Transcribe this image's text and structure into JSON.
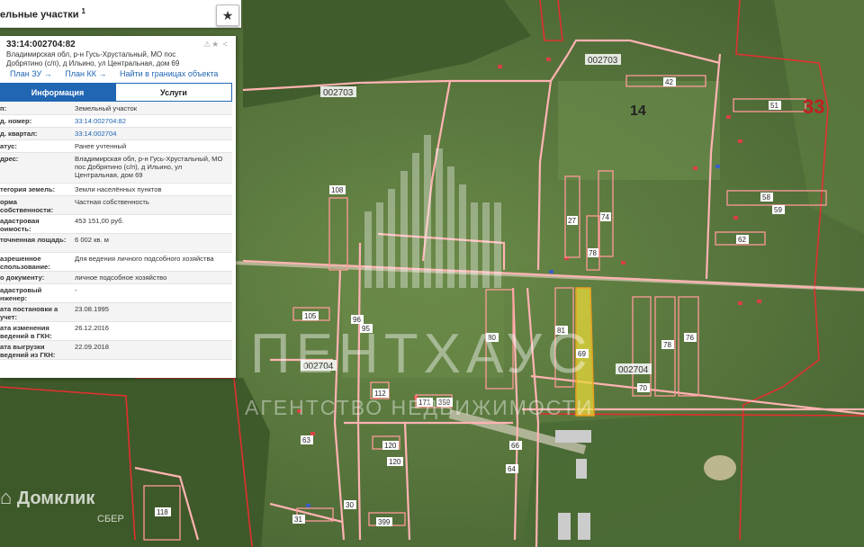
{
  "panel": {
    "header_title": "ельные участки",
    "header_sup": "1",
    "star_icon": "star-icon",
    "cad_number": "33:14:002704:82",
    "address": "Владимирская обл, р-н Гусь-Хрустальный, МО пос Добрятино (с/п), д Ильино, ул Центральная, дом 69",
    "corner_icons": "⚠★ <",
    "links": [
      "План ЗУ →",
      "План КК →",
      "Найти в границах объекта →"
    ],
    "tabs": {
      "info": "Информация",
      "services": "Услуги"
    },
    "rows": [
      {
        "k": "п:",
        "v": "Земельный участок",
        "link": false
      },
      {
        "k": "д. номер:",
        "v": "33:14:002704:82",
        "link": true
      },
      {
        "k": "д. квартал:",
        "v": "33:14:002704",
        "link": true
      },
      {
        "k": "атус:",
        "v": "Ранее учтенный",
        "link": false
      },
      {
        "k": "дрес:",
        "v": "Владимирская обл, р-н Гусь-Хрустальный, МО пос Добрятино (с/п), д Ильино, ул Центральная, дом 69",
        "link": false
      },
      {
        "k": "тегория земель:",
        "v": "Земли населённых пунктов",
        "link": false
      },
      {
        "k": "орма собственности:",
        "v": "Частная собственность",
        "link": false
      },
      {
        "k": "адастровая оимость:",
        "v": "453 151,00 руб.",
        "link": false
      },
      {
        "k": "точненная лощадь:",
        "v": "6 002 кв. м",
        "link": false
      },
      {
        "k": "азрешенное спользование:",
        "v": "Для ведения личного подсобного хозяйства",
        "link": false
      },
      {
        "k": "о документу:",
        "v": "личное подсобное хозяйство",
        "link": false
      },
      {
        "k": "адастровый нженер:",
        "v": "-",
        "link": false
      },
      {
        "k": "ата постановки а учет:",
        "v": "23.08.1995",
        "link": false
      },
      {
        "k": "ата изменения ведений в ГКН:",
        "v": "26.12.2016",
        "link": false
      },
      {
        "k": "ата выгрузки ведений из ГКН:",
        "v": "22.09.2018",
        "link": false
      }
    ]
  },
  "map": {
    "block_labels": [
      "002703",
      "002703",
      "002704",
      "002704"
    ],
    "quarter_labels": [
      "14",
      "33"
    ],
    "parcel_numbers": [
      "42",
      "51",
      "58",
      "59",
      "62",
      "27",
      "74",
      "78",
      "105",
      "108",
      "112",
      "171",
      "359",
      "120",
      "120",
      "118",
      "31",
      "30",
      "399",
      "69",
      "78",
      "76",
      "81",
      "80",
      "95",
      "96",
      "63",
      "64",
      "66",
      "70"
    ],
    "highlight_color": "#e8d83a",
    "parcel_color": "#ff8a8a",
    "boundary_color": "#e03030"
  },
  "watermarks": {
    "logo": "Домклик",
    "logo_sub": "СБЕР",
    "main": "ПЕНТХАУС",
    "sub": "АГЕНТСТВО НЕДВИЖИМОСТИ"
  }
}
